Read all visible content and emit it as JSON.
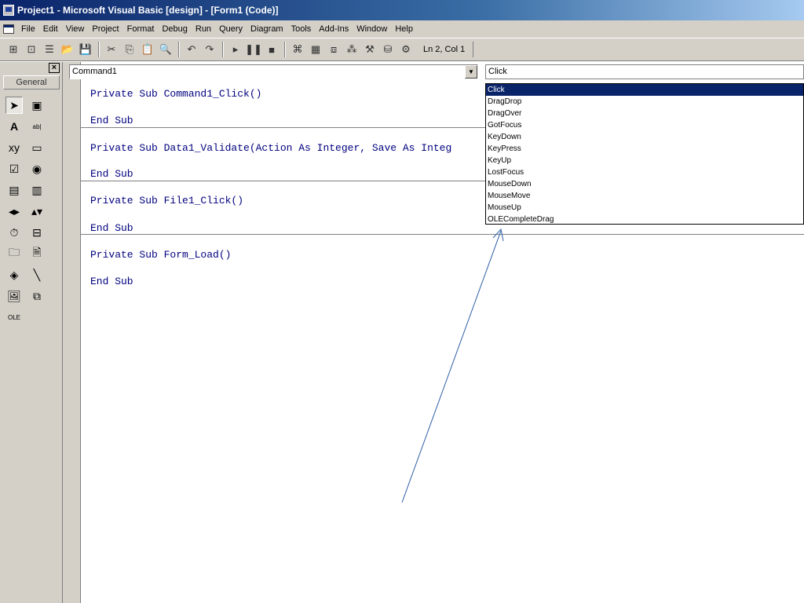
{
  "window": {
    "title": "Project1 - Microsoft Visual Basic [design] - [Form1 (Code)]"
  },
  "menu": [
    "File",
    "Edit",
    "View",
    "Project",
    "Format",
    "Debug",
    "Run",
    "Query",
    "Diagram",
    "Tools",
    "Add-Ins",
    "Window",
    "Help"
  ],
  "toolbar": {
    "position": "Ln 2, Col 1"
  },
  "toolbox": {
    "close_label": "×",
    "tab_label": "General",
    "tools": [
      {
        "name": "pointer-tool",
        "glyph": "➤"
      },
      {
        "name": "picturebox-tool",
        "glyph": "▣"
      },
      {
        "name": "label-tool",
        "glyph": "A"
      },
      {
        "name": "textbox-tool",
        "glyph": "ab|"
      },
      {
        "name": "frame-tool",
        "glyph": "xy"
      },
      {
        "name": "commandbutton-tool",
        "glyph": "▭"
      },
      {
        "name": "checkbox-tool",
        "glyph": "☑"
      },
      {
        "name": "optionbutton-tool",
        "glyph": "◉"
      },
      {
        "name": "combobox-tool",
        "glyph": "▤"
      },
      {
        "name": "listbox-tool",
        "glyph": "▥"
      },
      {
        "name": "hscrollbar-tool",
        "glyph": "◂▸"
      },
      {
        "name": "vscrollbar-tool",
        "glyph": "▴▾"
      },
      {
        "name": "timer-tool",
        "glyph": "⏱"
      },
      {
        "name": "drivelistbox-tool",
        "glyph": "⊟"
      },
      {
        "name": "dirlistbox-tool",
        "glyph": "🗀"
      },
      {
        "name": "filelistbox-tool",
        "glyph": "🗎"
      },
      {
        "name": "shape-tool",
        "glyph": "◈"
      },
      {
        "name": "line-tool",
        "glyph": "╲"
      },
      {
        "name": "image-tool",
        "glyph": "🖼"
      },
      {
        "name": "data-tool",
        "glyph": "⧉"
      },
      {
        "name": "ole-tool",
        "glyph": "OLE"
      }
    ]
  },
  "code": {
    "object": "Command1",
    "procedure": "Click",
    "lines": [
      "Private Sub Command1_Click()",
      "End Sub",
      "Private Sub Data1_Validate(Action As Integer, Save As Integ",
      "End Sub",
      "Private Sub File1_Click()",
      "End Sub",
      "Private Sub Form_Load()",
      "End Sub"
    ]
  },
  "procedure_list": [
    "Click",
    "DragDrop",
    "DragOver",
    "GotFocus",
    "KeyDown",
    "KeyPress",
    "KeyUp",
    "LostFocus",
    "MouseDown",
    "MouseMove",
    "MouseUp",
    "OLECompleteDrag"
  ],
  "colors": {
    "titlebar": "#0a246a",
    "code_text": "#00007f",
    "chrome": "#d4d0c8",
    "selection": "#0a246a"
  }
}
